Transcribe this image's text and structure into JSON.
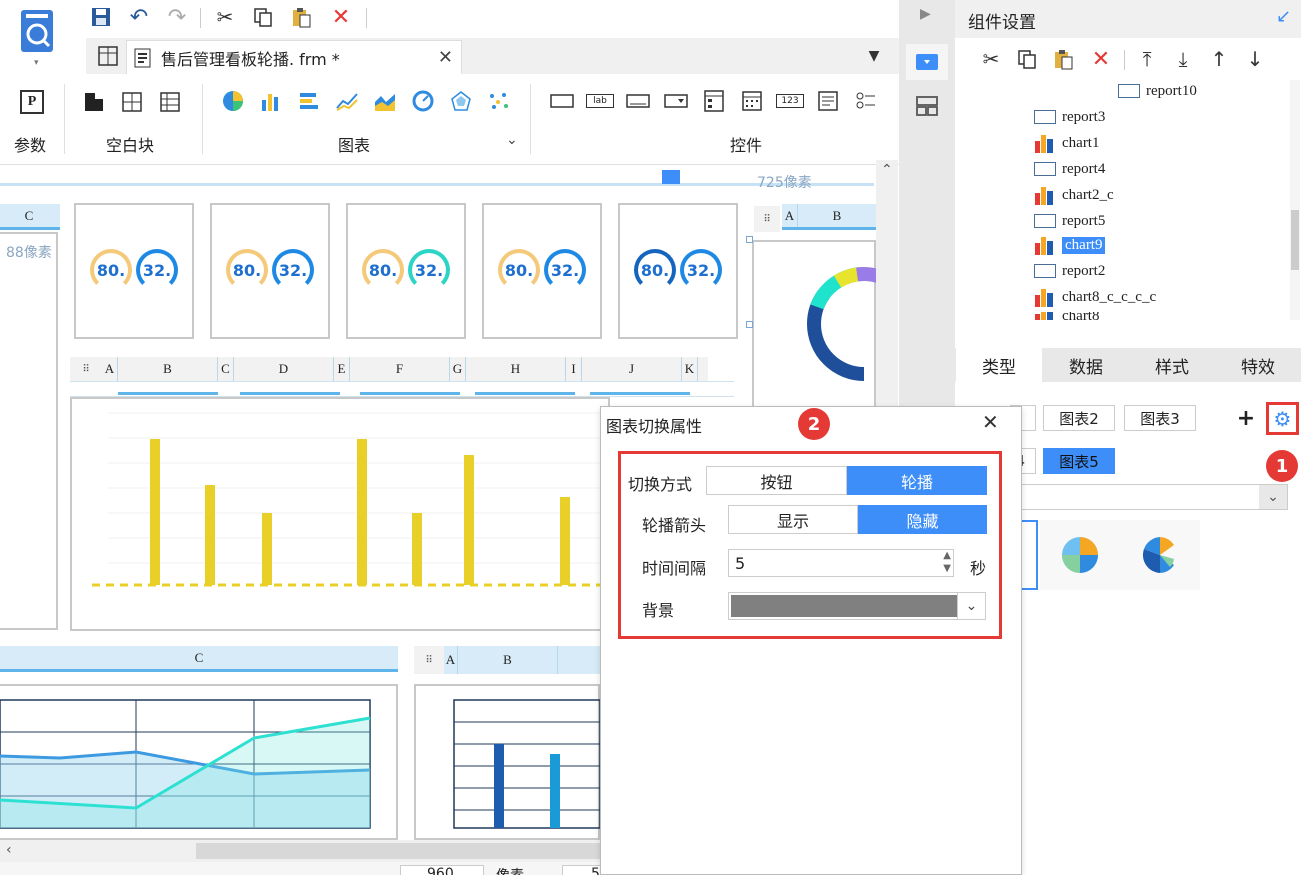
{
  "toolbar": {
    "groups": [
      {
        "label": "参数"
      },
      {
        "label": "空白块"
      },
      {
        "label": "图表"
      },
      {
        "label": "控件"
      }
    ],
    "param_icon_text": "P"
  },
  "editor_tab": {
    "title": "售后管理看板轮播. frm *"
  },
  "ruler": {
    "width_label": "725像素",
    "height_label": "88像素"
  },
  "gauges": [
    {
      "a": "80.",
      "b": "32."
    },
    {
      "a": "80.",
      "b": "32."
    },
    {
      "a": "80.",
      "b": "32."
    },
    {
      "a": "80.",
      "b": "32."
    },
    {
      "a": "80.",
      "b": "32."
    }
  ],
  "gauge_colors": [
    [
      "#f5c97a",
      "#1e88e5"
    ],
    [
      "#f5c97a",
      "#1e88e5"
    ],
    [
      "#f5c97a",
      "#2bd4c4"
    ],
    [
      "#f5c97a",
      "#1e88e5"
    ],
    [
      "#1565c0",
      "#1e88e5"
    ]
  ],
  "grid_top": {
    "columns": [
      "A",
      "B",
      "C",
      "D",
      "E",
      "F",
      "G",
      "H",
      "I",
      "J",
      "K"
    ]
  },
  "grid_right_top": {
    "columns": [
      "A",
      "B"
    ]
  },
  "grid_left_mid": {
    "column": "C"
  },
  "grid_left_bottom": {
    "column": "C"
  },
  "grid_bottom_right": {
    "columns": [
      "A",
      "B"
    ]
  },
  "status": {
    "size_value": "960",
    "unit": "像素",
    "extra": "5"
  },
  "right_panel": {
    "title": "组件设置"
  },
  "tree": {
    "items": [
      "report10",
      "report3",
      "chart1",
      "report4",
      "chart2_c",
      "report5",
      "chart9",
      "report2",
      "chart8_c_c_c_c",
      "chart8"
    ],
    "selected": "chart9"
  },
  "prop_tabs": [
    "类型",
    "数据",
    "样式",
    "特效"
  ],
  "chart_chips": [
    "图表2",
    "图表3",
    "4",
    "图表5"
  ],
  "selected_chip": "图表5",
  "dialog": {
    "title": "图表切换属性",
    "mode_label": "切换方式",
    "mode_options": [
      "按钮",
      "轮播"
    ],
    "mode_selected": "轮播",
    "arrow_label": "轮播箭头",
    "arrow_options": [
      "显示",
      "隐藏"
    ],
    "arrow_selected": "隐藏",
    "interval_label": "时间间隔",
    "interval_value": "5",
    "interval_unit": "秒",
    "bg_label": "背景",
    "bg_color": "#808080"
  },
  "markers": [
    "1",
    "2"
  ],
  "colors": {
    "accent": "#3d8ef8",
    "highlight_red": "#e53935",
    "bar_yellow": "#e8d028",
    "tab_bg": "#e8e8e8"
  }
}
